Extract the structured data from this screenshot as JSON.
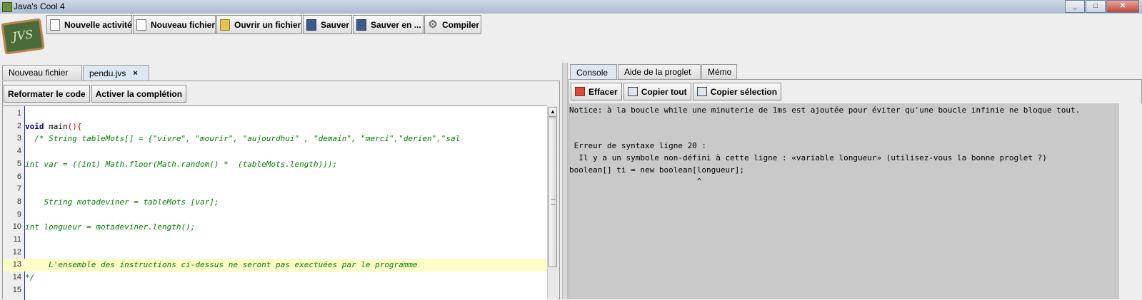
{
  "window": {
    "title": "Java's Cool 4"
  },
  "toolbar": {
    "buttons": [
      {
        "label": "Nouvelle activité",
        "icon": "document-icon"
      },
      {
        "label": "Nouveau fichier",
        "icon": "document-icon"
      },
      {
        "label": "Ouvrir un fichier",
        "icon": "open-folder-icon"
      },
      {
        "label": "Sauver",
        "icon": "floppy-disk-icon"
      },
      {
        "label": "Sauver en ...",
        "icon": "floppy-disk-icon"
      },
      {
        "label": "Compiler",
        "icon": "gear-icon"
      }
    ]
  },
  "editor_tabs": [
    {
      "label": "Nouveau fichier",
      "active": false
    },
    {
      "label": "pendu.jvs",
      "active": true,
      "close": "×"
    }
  ],
  "editor_toolbar": {
    "reformat_label": "Reformater le code",
    "completion_label": "Activer la complétion"
  },
  "code_lines": [
    {
      "n": "1",
      "text": ""
    },
    {
      "n": "2",
      "kw": "void",
      "rest": " main",
      "paren": "(){"
    },
    {
      "n": "3",
      "comment": "  /* String tableMots[] = {\"vivre\", \"mourir\", \"aujourdhui\" , \"demain\", \"merci\",\"derien\",\"sal"
    },
    {
      "n": "4",
      "text": ""
    },
    {
      "n": "5",
      "comment": "int var = ((int) Math.floor(Math.random() *  (tableMots.length)));"
    },
    {
      "n": "6",
      "text": ""
    },
    {
      "n": "7",
      "text": ""
    },
    {
      "n": "8",
      "comment": "    String motadeviner = tableMots [var];"
    },
    {
      "n": "9",
      "text": ""
    },
    {
      "n": "10",
      "comment": "int longueur = motadeviner.length();"
    },
    {
      "n": "11",
      "text": ""
    },
    {
      "n": "12",
      "text": ""
    },
    {
      "n": "13",
      "comment": "     L'ensemble des instructions ci-dessus ne seront pas exectuées par le programme",
      "highlight": true
    },
    {
      "n": "14",
      "comment": "*/"
    },
    {
      "n": "15",
      "text": ""
    }
  ],
  "right_tabs": [
    {
      "label": "Console",
      "active": true
    },
    {
      "label": "Aide de la proglet",
      "active": false
    },
    {
      "label": "Mémo",
      "active": false
    }
  ],
  "console_toolbar": {
    "clear_label": "Effacer",
    "copy_all_label": "Copier tout",
    "copy_selection_label": "Copier sélection"
  },
  "console_lines": [
    "Notice: à la boucle while une minuterie de 1ms est ajoutée pour éviter qu'une boucle infinie ne bloque tout.",
    "",
    "",
    " Erreur de syntaxe ligne 20 :",
    "  Il y a un symbole non-défini à cette ligne : «variable longueur» (utilisez-vous la bonne proglet ?)",
    "boolean[] ti = new boolean[longueur];",
    "                           ^"
  ],
  "colors": {
    "keyword": "#00008b",
    "paren": "#d00000",
    "comment": "#008000",
    "highlight": "#fdfdc8",
    "console_bg": "#c9c9c9"
  }
}
